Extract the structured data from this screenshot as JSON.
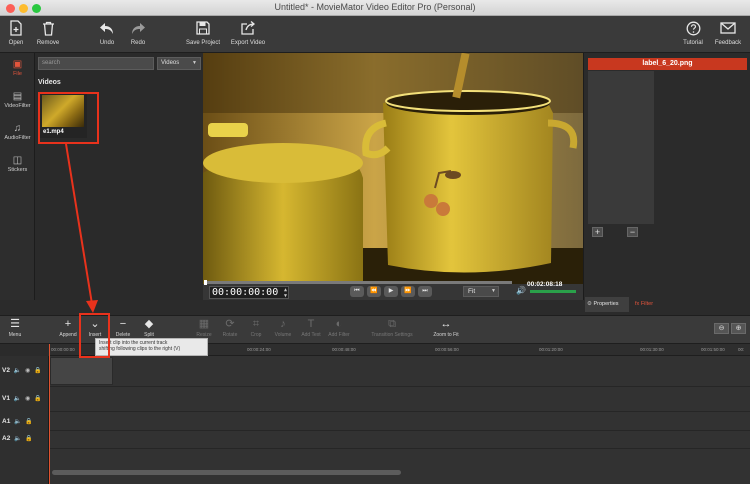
{
  "window": {
    "title": "Untitled* - MovieMator Video Editor Pro (Personal)"
  },
  "toolbar": {
    "open": "Open",
    "remove": "Remove",
    "undo": "Undo",
    "redo": "Redo",
    "save_project": "Save Project",
    "export_video": "Export Video",
    "tutorial": "Tutorial",
    "feedback": "Feedback"
  },
  "sidebar": {
    "tabs": [
      {
        "label": "File",
        "icon": "file-icon"
      },
      {
        "label": "VideoFilter",
        "icon": "video-filter-icon"
      },
      {
        "label": "AudioFilter",
        "icon": "music-note-icon"
      },
      {
        "label": "Stickers",
        "icon": "sticker-icon"
      }
    ]
  },
  "media": {
    "search_placeholder": "search",
    "filter_selected": "Videos",
    "section_title": "Videos",
    "items": [
      {
        "name": "e1.mp4"
      }
    ]
  },
  "player": {
    "current_time": "00:00:00:00",
    "total_time": "00:02:08:18",
    "zoom": "Fit"
  },
  "properties": {
    "header": "label_6_20.png",
    "add": "+",
    "remove": "−",
    "tabs": [
      {
        "label": "Properties"
      },
      {
        "label": "Filter"
      }
    ]
  },
  "timeline_toolbar": {
    "menu": "Menu",
    "append": "Append",
    "insert": "Insert",
    "delete": "Delete",
    "split": "Split",
    "resize": "Resize",
    "rotate": "Rotate",
    "crop": "Crop",
    "volume": "Volume",
    "add_text": "Add Text",
    "add_filter": "Add Filter",
    "transition_settings": "Transition Settings",
    "zoom_to_fit": "Zoom to Fit"
  },
  "tooltip": {
    "line1": "Insert clip into the current track",
    "line2": "shifting following clips to the right (V)"
  },
  "ruler": {
    "ticks": [
      "00:00:00:00",
      "00:00:08:00",
      "00:00:24:00",
      "00:00:48:00",
      "00:00:56:00",
      "00:01:20:00",
      "00:01:30:00",
      "00:01:50:00",
      "00:"
    ]
  },
  "tracks": [
    {
      "label": "V2"
    },
    {
      "label": "V1"
    },
    {
      "label": "A1"
    },
    {
      "label": "A2"
    }
  ],
  "colors": {
    "accent": "#e4553c",
    "annotation": "#e8321c"
  }
}
